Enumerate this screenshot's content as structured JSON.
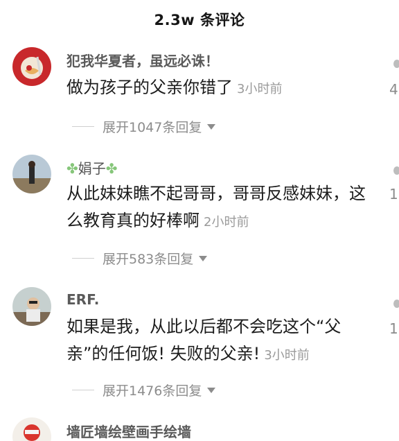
{
  "header": {
    "title": "2.3w 条评论"
  },
  "comments": [
    {
      "username": "犯我华夏者，虽远必诛！",
      "text": "做为孩子的父亲你错了",
      "time": "3小时前",
      "expand": "展开1047条回复",
      "right_count": "4"
    },
    {
      "username_prefix": "✤",
      "username": "娟子",
      "username_suffix": "✤",
      "text": "从此妹妹瞧不起哥哥，哥哥反感妹妹，这么教育真的好棒啊",
      "time": "2小时前",
      "expand": "展开583条回复",
      "right_count": "1"
    },
    {
      "username": "ERF.",
      "text": "如果是我，从此以后都不会吃这个“父亲”的任何饭! 失败的父亲!",
      "time": "3小时前",
      "expand": "展开1476条回复",
      "right_count": "1"
    },
    {
      "username": "墙匠墙绘壁画手绘墙"
    }
  ],
  "colors": {
    "text_primary": "#1c1c1c",
    "text_secondary": "#9a9a9a",
    "clover": "#86c67a"
  }
}
